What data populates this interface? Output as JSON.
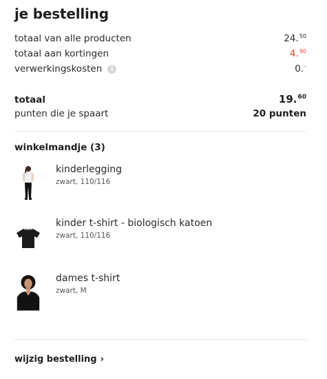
{
  "order": {
    "title": "je bestelling",
    "lines": [
      {
        "label": "totaal van alle producten",
        "price_int": "24.",
        "price_dec": "50"
      },
      {
        "label": "totaal aan kortingen",
        "price_int": "4.",
        "price_dec": "90"
      },
      {
        "label": "verwerkingskosten",
        "price_int": "0.",
        "price_dec": "-"
      }
    ],
    "total_label": "totaal",
    "total_int": "19.",
    "total_dec": "60",
    "points_label": "punten die je spaart",
    "points_value": "20 punten"
  },
  "cart": {
    "title": "winkelmandje (3)",
    "items": [
      {
        "name": "kinderlegging",
        "meta": "zwart, 110/116"
      },
      {
        "name": "kinder t-shirt - biologisch katoen",
        "meta": "zwart, 110/116"
      },
      {
        "name": "dames t-shirt",
        "meta": "zwart, M"
      }
    ]
  },
  "edit_link": "wijzig bestelling",
  "colors": {
    "discount": "#e4432d",
    "text": "#1e1e1e"
  },
  "icons": {
    "info": "info-icon",
    "chevron": "chevron-right-icon"
  }
}
